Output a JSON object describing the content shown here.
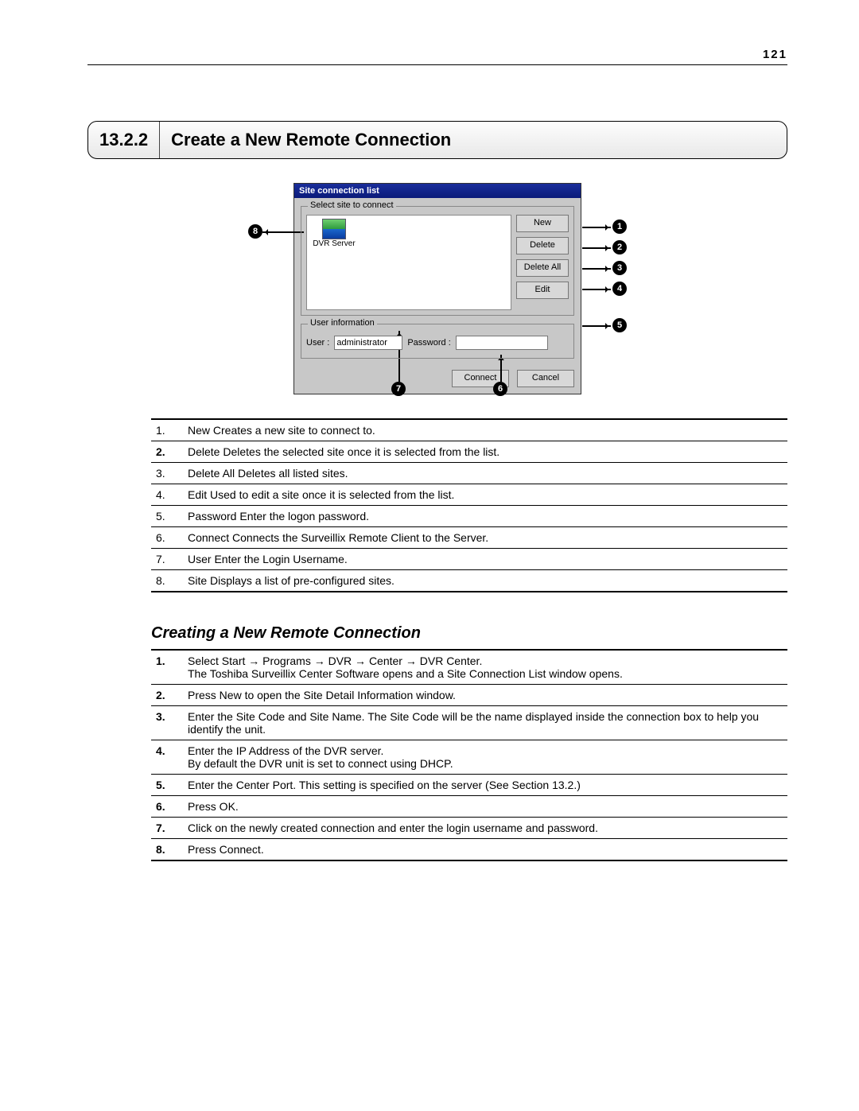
{
  "page_number": "121",
  "section": {
    "number": "13.2.2",
    "title": "Create a New Remote Connection"
  },
  "dialog": {
    "title": "Site connection list",
    "group_select_label": "Select site to connect",
    "site_item_label": "DVR Server",
    "buttons": {
      "new": "New",
      "delete": "Delete",
      "delete_all": "Delete All",
      "edit": "Edit",
      "connect": "Connect",
      "cancel": "Cancel"
    },
    "group_user_label": "User information",
    "user_label": "User :",
    "user_value": "administrator",
    "password_label": "Password :",
    "password_value": ""
  },
  "callouts": {
    "c1": "1",
    "c2": "2",
    "c3": "3",
    "c4": "4",
    "c5": "5",
    "c6": "6",
    "c7": "7",
    "c8": "8"
  },
  "legend": [
    {
      "num": "1.",
      "bold": false,
      "text": "New Creates a new site to connect to."
    },
    {
      "num": "2.",
      "bold": true,
      "text": "Delete Deletes the selected site once it is selected from the list."
    },
    {
      "num": "3.",
      "bold": false,
      "text": "Delete All Deletes all listed sites."
    },
    {
      "num": "4.",
      "bold": false,
      "text": "Edit Used to edit a site once it is selected from the list."
    },
    {
      "num": "5.",
      "bold": false,
      "text": "Password Enter the logon password."
    },
    {
      "num": "6.",
      "bold": false,
      "text": "Connect Connects the Surveillix Remote Client to the Server."
    },
    {
      "num": "7.",
      "bold": false,
      "text": "User Enter the Login Username."
    },
    {
      "num": "8.",
      "bold": false,
      "text": "Site Displays a list of pre-configured sites."
    }
  ],
  "subheading": "Creating a New Remote Connection",
  "steps": [
    {
      "num": "1.",
      "text": "Select Start → Programs → DVR → Center → DVR Center.\nThe Toshiba Surveillix Center Software opens and a Site Connection List window opens."
    },
    {
      "num": "2.",
      "text": "Press New to open the Site Detail Information window."
    },
    {
      "num": "3.",
      "text": "Enter the Site Code and Site Name.  The Site Code will be the name displayed inside the connection box to help you identify the unit."
    },
    {
      "num": "4.",
      "text": "Enter the IP Address of the DVR server.\nBy default the DVR unit is set to connect using DHCP."
    },
    {
      "num": "5.",
      "text": "Enter the Center Port.  This setting is specified on the server (See Section 13.2.)"
    },
    {
      "num": "6.",
      "text": "Press OK."
    },
    {
      "num": "7.",
      "text": "Click on the newly created connection and enter the login username and password."
    },
    {
      "num": "8.",
      "text": "Press Connect."
    }
  ]
}
